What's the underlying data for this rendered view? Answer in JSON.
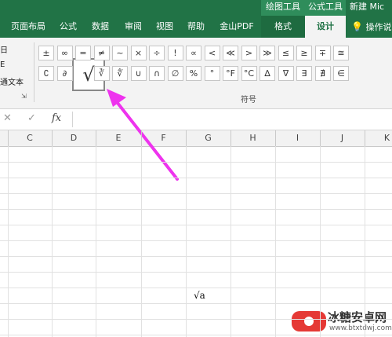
{
  "app": {
    "context_tabs": [
      "绘图工具",
      "公式工具"
    ],
    "title": "新建 Mic"
  },
  "ribbon_tabs": [
    "页面布局",
    "公式",
    "数据",
    "审阅",
    "视图",
    "帮助",
    "金山PDF",
    "格式",
    "设计"
  ],
  "active_tab": "设计",
  "tell_me": "操作说",
  "left_panel": [
    "日",
    "E",
    "通文本"
  ],
  "symbols_row1": [
    "±",
    "∞",
    "=",
    "≠",
    "~",
    "×",
    "÷",
    "!",
    "∝",
    "<",
    "≪",
    ">",
    "≫",
    "≤",
    "≥",
    "∓",
    "≅"
  ],
  "symbols_row2": [
    "∁",
    "∂",
    "√",
    "∛",
    "∜",
    "∪",
    "∩",
    "∅",
    "%",
    "°",
    "°F",
    "°C",
    "∆",
    "∇",
    "∃",
    "∄",
    "∈"
  ],
  "selected_symbol": "√",
  "symbols_group_label": "符号",
  "formula_bar": {
    "cancel": "✕",
    "confirm": "✓",
    "fx": "fx",
    "value": ""
  },
  "columns": [
    "C",
    "D",
    "E",
    "F",
    "G",
    "H",
    "I",
    "J",
    "K"
  ],
  "equation_object": "√a",
  "watermark": {
    "name": "冰糖安卓网",
    "url": "www.btxtdwj.com"
  },
  "colors": {
    "excel_green": "#217346",
    "arrow": "#ee33ee"
  }
}
